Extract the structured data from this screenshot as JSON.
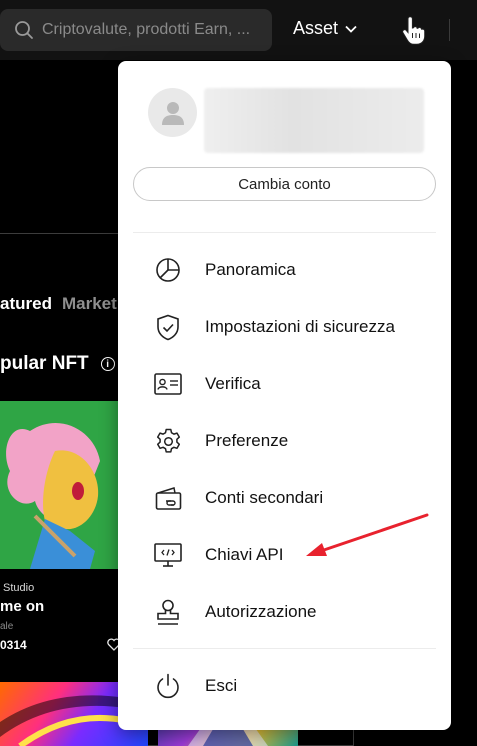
{
  "search": {
    "placeholder": "Criptovalute, prodotti Earn, ..."
  },
  "nav": {
    "asset_label": "Asset"
  },
  "background": {
    "tabs": [
      "atured",
      "Market"
    ],
    "section_title": "pular NFT",
    "info_icon_glyph": "i",
    "nft_studio": "Studio",
    "nft_title": "me on",
    "nft_sale": "ale",
    "nft_price": "0314"
  },
  "dropdown": {
    "switch_account_label": "Cambia conto",
    "items": [
      {
        "label": "Panoramica",
        "icon": "pie-chart-icon"
      },
      {
        "label": "Impostazioni di sicurezza",
        "icon": "shield-icon"
      },
      {
        "label": "Verifica",
        "icon": "id-card-icon"
      },
      {
        "label": "Preferenze",
        "icon": "gear-icon"
      },
      {
        "label": "Conti secondari",
        "icon": "sub-accounts-icon"
      },
      {
        "label": "Chiavi API",
        "icon": "api-monitor-icon"
      },
      {
        "label": "Autorizzazione",
        "icon": "stamp-icon"
      }
    ],
    "logout_label": "Esci"
  },
  "colors": {
    "annotation_arrow": "#e8222e",
    "dropdown_bg": "#ffffff",
    "topbar_bg": "#121212"
  }
}
